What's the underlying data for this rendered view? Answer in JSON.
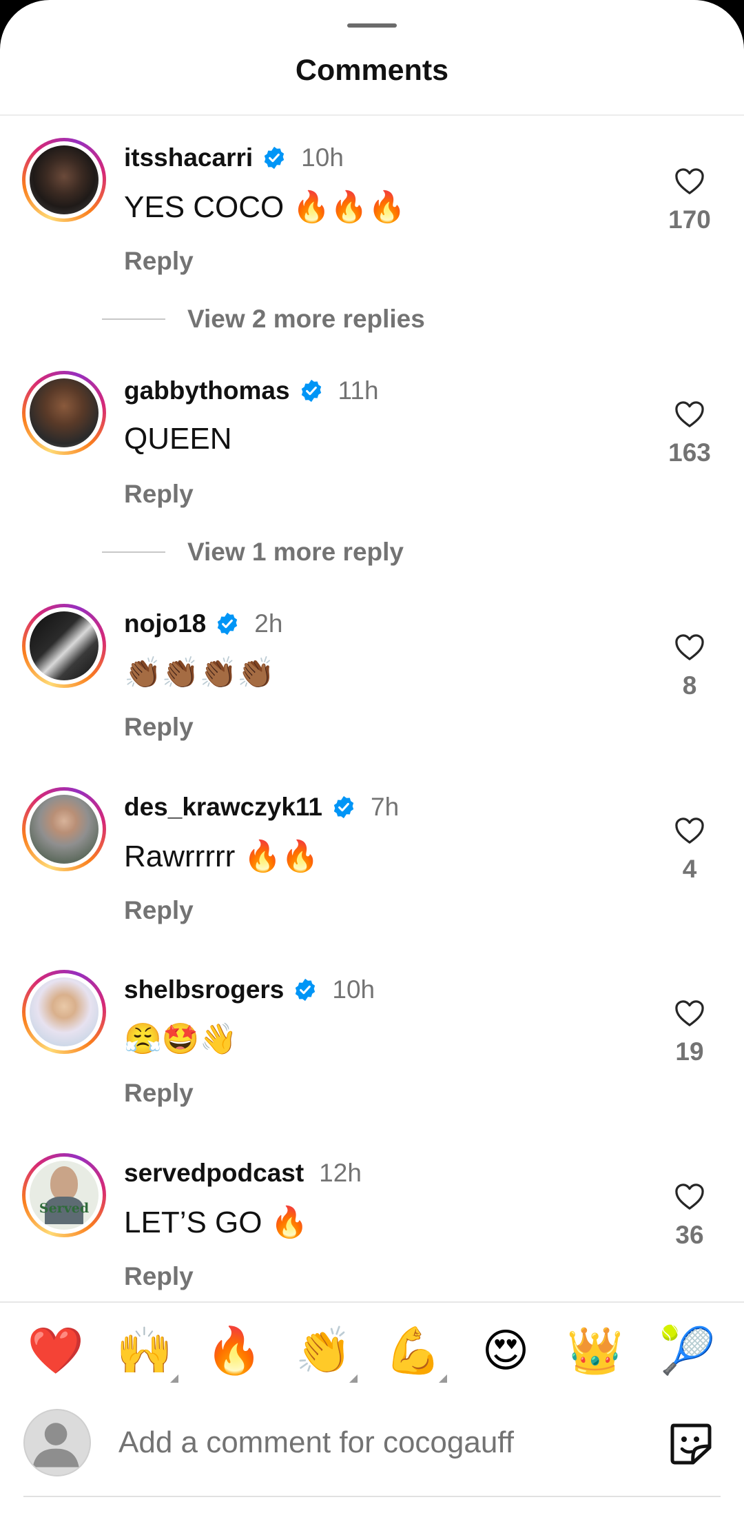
{
  "sheet": {
    "title": "Comments"
  },
  "comments": [
    {
      "username": "itsshacarri",
      "verified": true,
      "time": "10h",
      "text": "YES COCO 🔥🔥🔥",
      "reply_label": "Reply",
      "likes": "170",
      "view_more": "View 2 more replies"
    },
    {
      "username": "gabbythomas",
      "verified": true,
      "time": "11h",
      "text": "QUEEN",
      "reply_label": "Reply",
      "likes": "163",
      "view_more": "View 1 more reply"
    },
    {
      "username": "nojo18",
      "verified": true,
      "time": "2h",
      "text": "👏🏾👏🏾👏🏾👏🏾",
      "reply_label": "Reply",
      "likes": "8"
    },
    {
      "username": "des_krawczyk11",
      "verified": true,
      "time": "7h",
      "text": "Rawrrrrr 🔥🔥",
      "reply_label": "Reply",
      "likes": "4"
    },
    {
      "username": "shelbsrogers",
      "verified": true,
      "time": "10h",
      "text": "😤🤩👋",
      "reply_label": "Reply",
      "likes": "19"
    },
    {
      "username": "servedpodcast",
      "verified": false,
      "time": "12h",
      "text": "LET’S GO 🔥",
      "reply_label": "Reply",
      "likes": "36",
      "avatar_text": "Served"
    }
  ],
  "quick_reactions": [
    "❤️",
    "🙌",
    "🔥",
    "👏",
    "💪",
    "😍",
    "👑",
    "🎾"
  ],
  "composer": {
    "placeholder": "Add a comment for cocogauff"
  },
  "colors": {
    "verified": "#0095f6",
    "muted": "#737373",
    "text": "#111111"
  },
  "icons": {
    "like": "heart-outline-icon",
    "verified": "verified-badge-icon",
    "sticker": "sticker-icon"
  }
}
